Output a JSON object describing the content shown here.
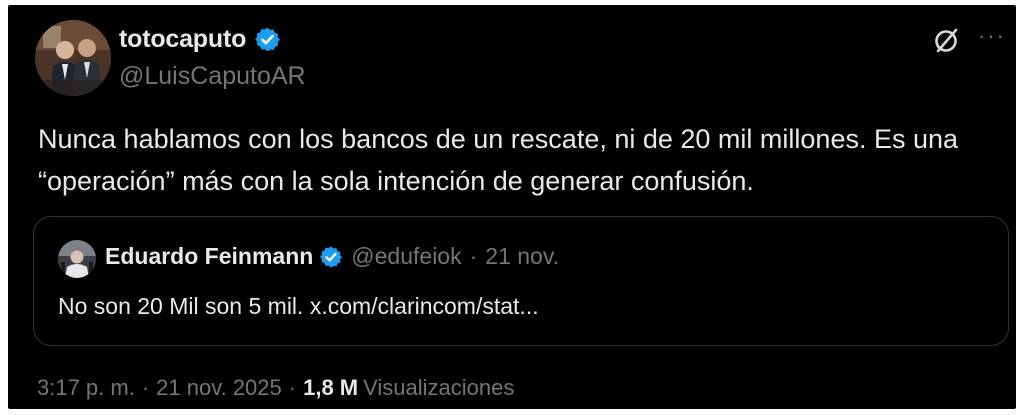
{
  "author": {
    "display_name": "totocaputo",
    "handle": "@LuisCaputoAR",
    "avatar_icon": "profile-photo",
    "verified_icon": "verified-badge-icon"
  },
  "actions": {
    "grok_icon": "grok-icon",
    "more_label": "···"
  },
  "tweet": {
    "text": "Nunca hablamos con los bancos de un rescate, ni de 20 mil millones. Es una “operación” más con la sola intención de generar confusión."
  },
  "quote": {
    "display_name": "Eduardo Feinmann",
    "handle": "@edufeiok",
    "separator": "·",
    "date": "21 nov.",
    "text": "No son 20 Mil son 5 mil. x.com/clarincom/stat..."
  },
  "meta": {
    "time": "3:17 p. m.",
    "separator1": "·",
    "date": "21 nov. 2025",
    "separator2": "·",
    "views_count": "1,8 M",
    "views_label": "Visualizaciones"
  },
  "colors": {
    "background": "#000000",
    "text_primary": "#e7e9ea",
    "text_secondary": "#71767b",
    "verified_blue": "#1d9bf0",
    "border": "#2f3336"
  }
}
